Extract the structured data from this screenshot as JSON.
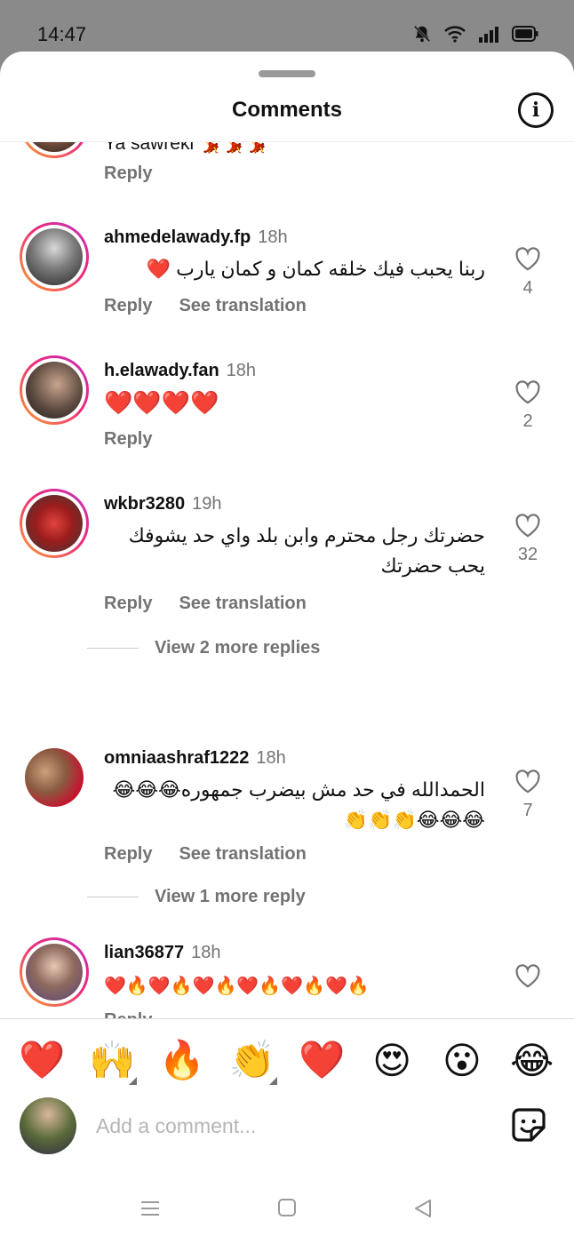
{
  "status_bar": {
    "time": "14:47"
  },
  "sheet": {
    "title": "Comments"
  },
  "partial_comment": {
    "text": "Ya sawreki 💃💃💃",
    "reply_label": "Reply"
  },
  "comments": [
    {
      "username": "ahmedelawady.fp",
      "time": "18h",
      "text": "ربنا يحبب فيك خلقه كمان و كمان يارب ❤️",
      "reply_label": "Reply",
      "translate_label": "See translation",
      "likes": "4"
    },
    {
      "username": "h.elawady.fan",
      "time": "18h",
      "text": "❤️❤️❤️❤️",
      "reply_label": "Reply",
      "likes": "2"
    },
    {
      "username": "wkbr3280",
      "time": "19h",
      "text": "حضرتك رجل محترم وابن بلد واي حد يشوفك يحب حضرتك",
      "reply_label": "Reply",
      "translate_label": "See translation",
      "likes": "32",
      "view_replies": "View 2 more replies"
    },
    {
      "username": "omniaashraf1222",
      "time": "18h",
      "text": "الحمدالله في حد مش بيضرب جمهوره😂😂😂 😂😂😂👏👏👏",
      "reply_label": "Reply",
      "translate_label": "See translation",
      "likes": "7",
      "view_replies": "View 1 more reply"
    },
    {
      "username": "lian36877",
      "time": "18h",
      "text": "❤️🔥❤️🔥❤️🔥❤️🔥❤️🔥❤️🔥",
      "reply_label": "Reply",
      "likes": ""
    }
  ],
  "reactions": [
    "❤️",
    "🙌",
    "🔥",
    "👏",
    "❤️",
    "😍",
    "😮",
    "😂"
  ],
  "composer": {
    "placeholder": "Add a comment..."
  },
  "colors": {
    "accent_ring_start": "#f9a230",
    "accent_ring_end": "#c22fbf",
    "muted": "#737373",
    "heart": "#e0162b"
  }
}
